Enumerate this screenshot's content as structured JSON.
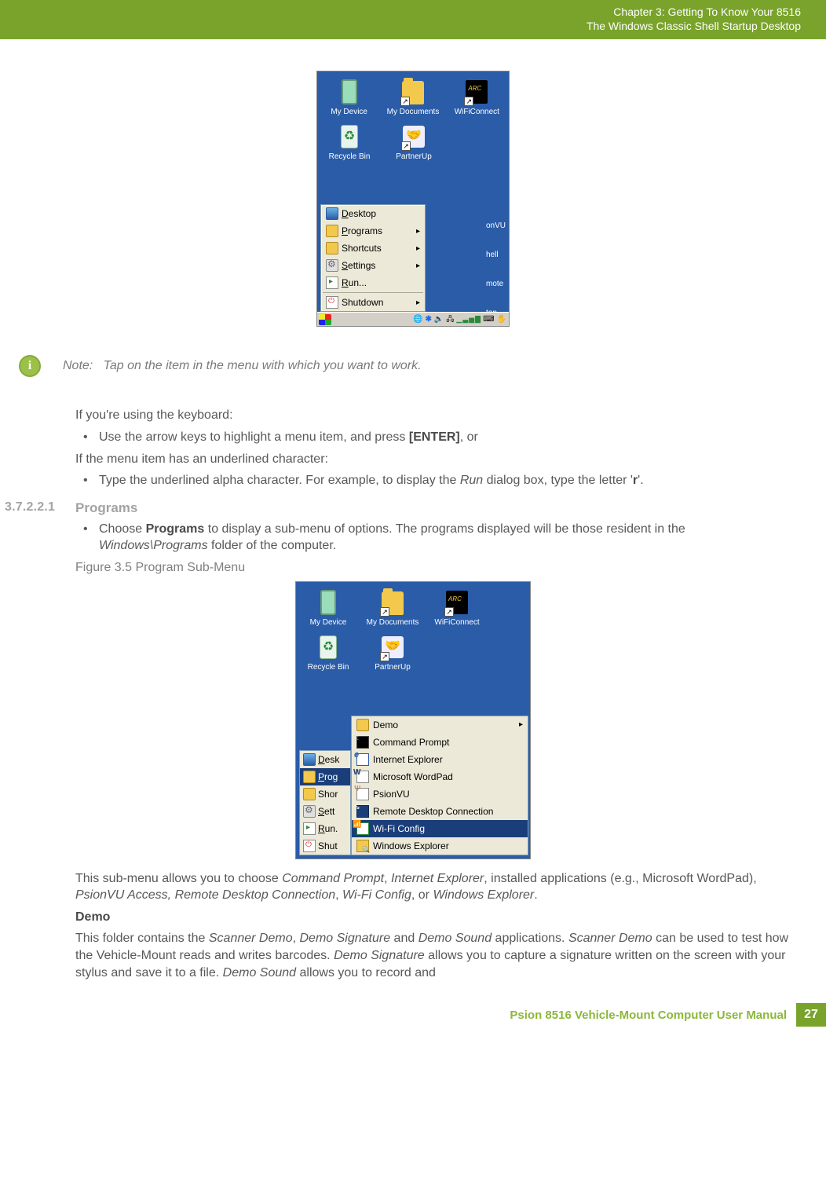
{
  "header": {
    "chapter_line": "Chapter 3:  Getting To Know Your 8516",
    "subtitle": "The Windows Classic Shell Startup Desktop"
  },
  "figure1": {
    "desktop_icons_row1": [
      {
        "label": "My Device",
        "type": "pda"
      },
      {
        "label": "My Documents",
        "type": "folder"
      },
      {
        "label": "WiFiConnect",
        "type": "arc"
      }
    ],
    "desktop_icons_row2": [
      {
        "label": "Recycle Bin",
        "type": "recycle"
      },
      {
        "label": "PartnerUp",
        "type": "hands"
      }
    ],
    "behind_fragments": [
      "onVU",
      "hell",
      "mote",
      "top ..."
    ],
    "start_menu": [
      {
        "label": "Desktop",
        "icon": "monitor",
        "submenu": false
      },
      {
        "label": "Programs",
        "icon": "fold-o",
        "submenu": true
      },
      {
        "label": "Shortcuts",
        "icon": "fold-o",
        "submenu": true
      },
      {
        "label": "Settings",
        "icon": "gear",
        "submenu": true
      },
      {
        "label": "Run...",
        "icon": "run",
        "submenu": false
      },
      {
        "sep": true
      },
      {
        "label": "Shutdown",
        "icon": "shut",
        "submenu": true
      }
    ]
  },
  "note": {
    "label": "Note:",
    "text": "Tap on the item in the menu with which you want to work."
  },
  "para_keyboard_intro": "If you're using the keyboard:",
  "bullet_keyboard": {
    "pre": "Use the arrow keys to highlight a menu item, and press ",
    "key": "[ENTER]",
    "post": ", or"
  },
  "para_underlined_intro": "If the menu item has an underlined character:",
  "bullet_underlined": {
    "pre": "Type the underlined alpha character. For example, to display the ",
    "run_ital": "Run",
    "mid": " dialog box, type the letter '",
    "r_bold": "r",
    "post": "'."
  },
  "section": {
    "number": "3.7.2.2.1",
    "title": "Programs"
  },
  "bullet_programs": {
    "pre": "Choose ",
    "bold": "Programs",
    "mid": " to display a sub-menu of options. The programs displayed will be those resident in the ",
    "path_ital": "Windows\\Programs",
    "post": " folder of the computer."
  },
  "figure_caption": "Figure 3.5    Program Sub-Menu",
  "figure2": {
    "desktop_icons_row1": [
      {
        "label": "My Device",
        "type": "pda"
      },
      {
        "label": "My Documents",
        "type": "folder"
      },
      {
        "label": "WiFiConnect",
        "type": "arc"
      }
    ],
    "desktop_icons_row2": [
      {
        "label": "Recycle Bin",
        "type": "recycle"
      },
      {
        "label": "PartnerUp",
        "type": "hands"
      }
    ],
    "start_menu_left": [
      {
        "label": "Desk",
        "icon": "monitor"
      },
      {
        "label": "Prog",
        "icon": "fold-o",
        "hl": true
      },
      {
        "label": "Shor",
        "icon": "fold-o"
      },
      {
        "label": "Sett",
        "icon": "gear"
      },
      {
        "label": "Run.",
        "icon": "run"
      },
      {
        "sep": true
      },
      {
        "label": "Shut",
        "icon": "shut"
      }
    ],
    "submenu": [
      {
        "label": "Demo",
        "icon": "fold-o",
        "submenu": true
      },
      {
        "label": "Command Prompt",
        "icon": "cmd"
      },
      {
        "label": "Internet Explorer",
        "icon": "ie"
      },
      {
        "label": "Microsoft WordPad",
        "icon": "wpad"
      },
      {
        "label": "PsionVU",
        "icon": "pvu"
      },
      {
        "label": "Remote Desktop Connection",
        "icon": "rdc"
      },
      {
        "label": "Wi-Fi Config",
        "icon": "wifi",
        "hl": true
      },
      {
        "label": "Windows Explorer",
        "icon": "wexp"
      }
    ]
  },
  "para_submenu": {
    "pre": "This sub-menu allows you to choose ",
    "i1": "Command Prompt",
    "c1": ", ",
    "i2": "Internet Explorer",
    "mid": ", installed applications (e.g., Microsoft WordPad), ",
    "i3": "PsionVU Access, Remote Desktop Connection",
    "c2": ", ",
    "i4": "Wi-Fi Config",
    "c3": ", or ",
    "i5": "Windows Explorer",
    "post": "."
  },
  "demo_heading": "Demo",
  "para_demo": {
    "pre": "This folder contains the ",
    "i1": "Scanner Demo",
    "c1": ", ",
    "i2": "Demo Signature",
    "c2": " and ",
    "i3": "Demo Sound",
    "mid1": " applications. ",
    "i4": "Scanner Demo",
    "mid2": " can be used to test how the Vehicle-Mount reads and writes barcodes. ",
    "i5": "Demo Signature",
    "mid3": " allows you to capture a signature written on the screen with your stylus and save it to a file. ",
    "i6": "Demo Sound",
    "post": " allows you to record and"
  },
  "footer": {
    "title": "Psion 8516 Vehicle-Mount Computer User Manual",
    "page": "27"
  }
}
